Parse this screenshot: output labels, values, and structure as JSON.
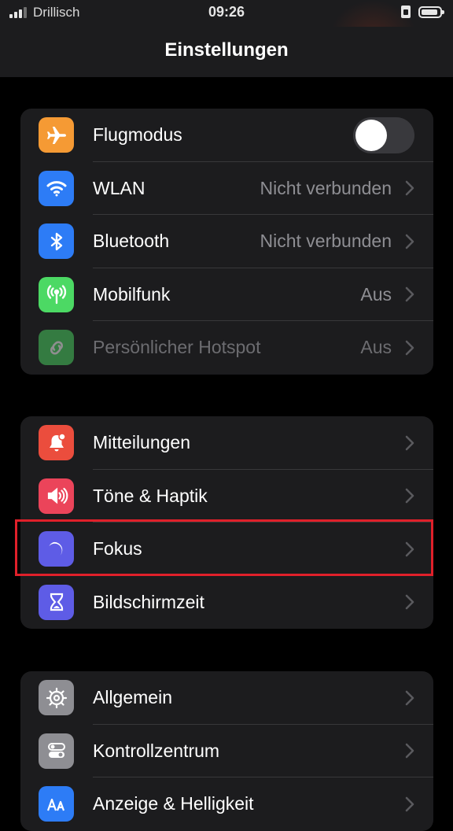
{
  "status_bar": {
    "carrier": "Drillisch",
    "time": "09:26"
  },
  "header": {
    "title": "Einstellungen"
  },
  "colors": {
    "airplane": "#f59a34",
    "wifi": "#2d7cf6",
    "bluetooth": "#2d7cf6",
    "cellular": "#4cd964",
    "hotspot": "#4cd964",
    "notifications": "#eb4d3d",
    "sounds": "#eb445a",
    "focus": "#5e5ce6",
    "screen_time": "#5e5ce6",
    "general": "#8e8e93",
    "control_center": "#8e8e93",
    "display": "#2d7cf6",
    "highlight": "#e0202a"
  },
  "groups": [
    {
      "items": [
        {
          "label": "Flugmodus",
          "icon": "airplane-icon",
          "toggle": false
        },
        {
          "label": "WLAN",
          "value": "Nicht verbunden",
          "icon": "wifi-icon"
        },
        {
          "label": "Bluetooth",
          "value": "Nicht verbunden",
          "icon": "bluetooth-icon"
        },
        {
          "label": "Mobilfunk",
          "value": "Aus",
          "icon": "antenna-icon"
        },
        {
          "label": "Persönlicher Hotspot",
          "value": "Aus",
          "icon": "hotspot-link-icon",
          "disabled": true
        }
      ]
    },
    {
      "items": [
        {
          "label": "Mitteilungen",
          "icon": "bell-icon"
        },
        {
          "label": "Töne & Haptik",
          "icon": "speaker-icon"
        },
        {
          "label": "Fokus",
          "icon": "moon-icon",
          "highlighted": true
        },
        {
          "label": "Bildschirmzeit",
          "icon": "hourglass-icon"
        }
      ]
    },
    {
      "items": [
        {
          "label": "Allgemein",
          "icon": "gear-icon"
        },
        {
          "label": "Kontrollzentrum",
          "icon": "toggles-icon"
        },
        {
          "label": "Anzeige & Helligkeit",
          "icon": "display-aa-icon"
        }
      ]
    }
  ]
}
